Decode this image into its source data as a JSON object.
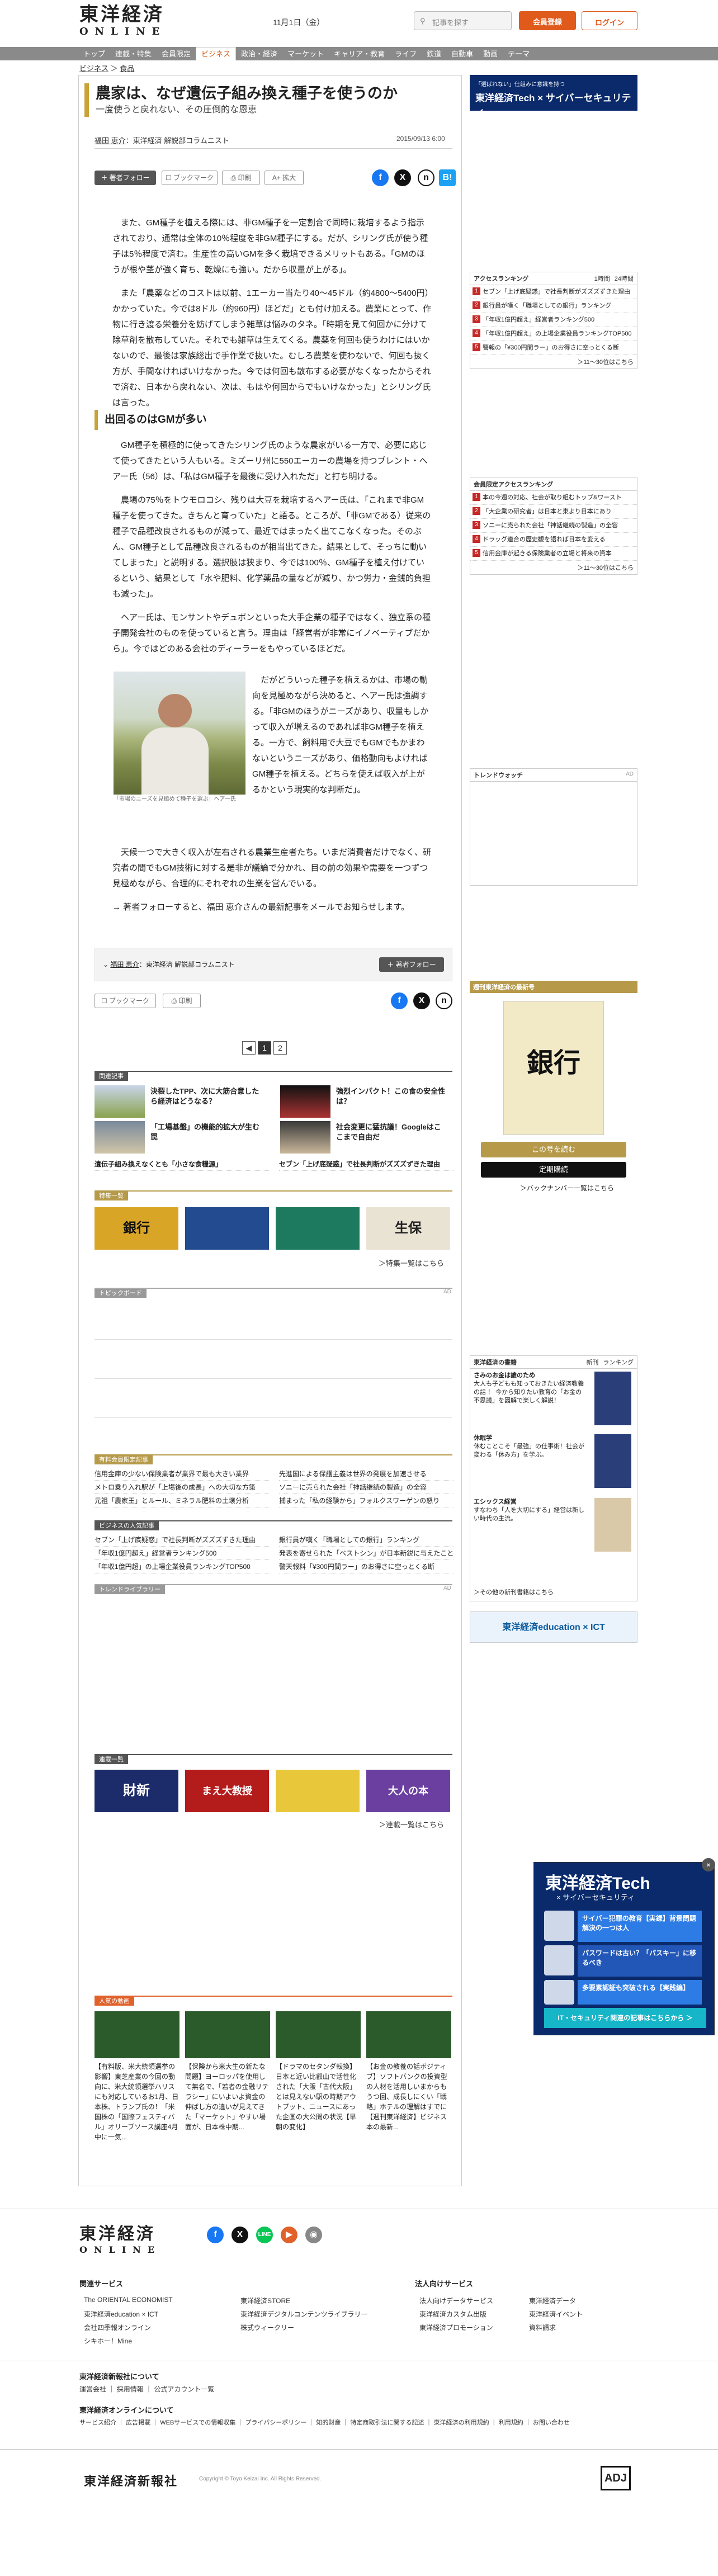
{
  "header": {
    "logo_jp": "東洋経済",
    "logo_en": "ONLINE",
    "date": "11月1日（金）",
    "search_placeholder": "記事を探す",
    "member_label": "会員登録",
    "login_label": "ログイン"
  },
  "nav": {
    "items": [
      "トップ",
      "連載・特集",
      "会員限定",
      "ビジネス",
      "政治・経済",
      "マーケット",
      "キャリア・教育",
      "ライフ",
      "鉄道",
      "自動車",
      "動画",
      "テーマ"
    ],
    "active": "ビジネス"
  },
  "breadcrumb": [
    "ビジネス",
    "食品"
  ],
  "article": {
    "title": "農家は、なぜ遺伝子組み換え種子を使うのか",
    "subtitle": "一度使うと戻れない、その圧倒的な恩恵",
    "author_name": "福田 恵介",
    "author_role": "：東洋経済 解説部コラムニスト",
    "date": "2015/09/13 6:00",
    "follow_label": "著者フォロー",
    "bookmark_label": "ブックマーク",
    "print_label": "印刷",
    "font_label": "A+ 拡大",
    "paras1": [
      "また、GM種子を植える際には、非GM種子を一定割合で同時に栽培するよう指示されており、通常は全体の10％程度を非GM種子にする。だが、シリング氏が使う種子は5％程度で済む。生産性の高いGMを多く栽培できるメリットもある。「GMのほうが根や茎が強く育ち、乾燥にも強い。だから収量が上がる」。",
      "また「農薬などのコストは以前、1エーカー当たり40～45ドル（約4800～5400円）かかっていた。今では8ドル（約960円）ほどだ」とも付け加える。農業にとって、作物に行き渡る栄養分を妨げてしまう雑草は悩みのタネ。「時期を見て何回かに分けて除草剤を散布していた。それでも雑草は生えてくる。農薬を何回も使うわけにはいかないので、最後は家族総出で手作業で抜いた。むしろ農薬を使わないで、何回も抜く方が、手間なければいけなかった。今では何回も散布する必要がなくなったからそれで済む、日本から戻れない、次は、もはや何回からでもいけなかった」とシリング氏は言った。"
    ],
    "section1": "出回るのはGMが多い",
    "paras2": [
      "GM種子を積極的に使ってきたシリング氏のような農家がいる一方で、必要に応じて使ってきたという人もいる。ミズーリ州に550エーカーの農場を持つブレント・ヘアー氏（56）は、「私はGM種子を最後に受け入れただ」と打ち明ける。",
      "農場の75％をトウモロコシ、残りは大豆を栽培するヘアー氏は、「これまで非GM種子を使ってきた。きちんと育っていた」と語る。ところが、「非GMである）従来の種子で品種改良されるものが減って、最近ではまったく出てこなくなった。そのぶん、GM種子として品種改良されるものが相当出てきた。結果として、そっちに動いてしまった」と説明する。選択肢は狭まり、今では100％、GM種子を植え付けているという、結果として「水や肥料、化学薬品の量などが減り、かつ労力・金銭的負担も減った」。",
      "ヘアー氏は、モンサントやデュポンといった大手企業の種子ではなく、独立系の種子開発会社のものを使っていると言う。理由は「経営者が非常にイノベーティブだから」。今ではどのある会社のディーラーをもやっているほどだ。"
    ],
    "paras3": [
      "だがどういった種子を植えるかは、市場の動向を見極めながら決めると、ヘアー氏は強調する。「非GMのほうがニーズがあり、収量もしかって収入が増えるのであれば非GM種子を植える。一方で、飼料用で大豆でもGMでもかまわないというニーズがあり、価格動向もよければGM種子を植える。どちらを使えば収入が上がるかという現実的な判断だ」。",
      "天候一つで大きく収入が左右される農業生産者たち。いまだ消費者だけでなく、研究者の間でもGM技術に対する是非が議論で分かれ、目の前の効果や需要を一つずつ見極めながら、合理的にそれぞれの生業を営んでいる。"
    ],
    "photo_caption": "「市場のニーズを見極めて種子を選ぶ」ヘアー氏",
    "follow_note": "→ 著者フォローすると、福田 恵介さんの最新記事をメールでお知らせします。",
    "pages": [
      "1",
      "2"
    ]
  },
  "related": {
    "heading": "関連記事",
    "cards": [
      "決裂したTPP、次に大筋合意したら経済はどうなる？",
      "「工場基盤」の機能的拡大が生む罠",
      "強烈インパクト！この食の安全性は？",
      "社会変更に猛抗議！Googleはここまで自由だ"
    ],
    "links": [
      "遺伝子組み換えなくとも「小さな食糧源」",
      "セブン「上げ底疑惑」で社長判断がズズズずきた理由"
    ]
  },
  "special": {
    "heading": "特集一覧",
    "more": "＞特集一覧はこちら",
    "tiles": [
      "銀行",
      "",
      "",
      "生保"
    ]
  },
  "topic_board": {
    "heading": "トピックボード",
    "ad": "AD"
  },
  "popular": {
    "heading": "有料会員限定記事",
    "left": [
      "信用金庫の少ない保険業者が業界で最も大きい業界",
      "メトロ乗り入れ駅が「上場後の成長」への大切な方策",
      "元祖「農家王」とルール、ミネラル肥料の土壌分析"
    ],
    "right": [
      "先進国による保護主義は世界の発展を加速させる",
      "ソニーに売られた会社「神話継続の製造」の全容",
      "捕まった「私の経験から」フォルクスワーゲンの怒り"
    ]
  },
  "ranking_mid": {
    "heading": "ビジネスの人気記事",
    "left": [
      "セブン「上げ底疑惑」で社長判断がズズズずきた理由",
      "「年収1億円超え」経営者ランキング500",
      "「年収1億円超」の上場企業役員ランキングTOP500"
    ],
    "right": [
      "銀行員が嘆く「職場としての銀行」ランキング",
      "発表を寄せられた「ベストシン」が日本新鋭に与えたこと",
      "警天報料「¥300円間ラー」のお得さに空っとくる断"
    ]
  },
  "trend_library": {
    "heading": "トレンドライブラリー",
    "ad": "AD"
  },
  "serial": {
    "heading": "連載一覧",
    "more": "＞連載一覧はこちら",
    "tiles": [
      "財新",
      "まえ大教授",
      "",
      "大人の本"
    ]
  },
  "ranking_bottom": {
    "heading": "人気の動画",
    "cards": [
      "【有料版、米大統領選挙の影響】東芝産業の今回の動向に、米大統領選挙ハリスにも対応しているお1月、日本株、トランプ氏の！「米国株の「国際フェスティバル」オリーブソース講座4月中に一気...",
      "【保険から米大生の新たな問題】ヨーロッパを使用して無名で、「若者の金融リテラシー」にいよいよ資金の伸ばし方の違いが見えてきた「マーケット」やすい場面が、日本株中期...",
      "【ドラマのセタンダ転換】日本と近い比叡山で活性化された「大阪「古代大阪」とは見えない駅の時期アウトプット、ニュースにあった企画の大公開の状況【早朝の変化】",
      "【お金の教養の話ボジティブ】ソフトバンクの投資型の人材を活用しいまからもうつ回、成長しにくい「戦略」ホテルの理解はすでに【週刊東洋経済】ビジネス本の最新..."
    ]
  },
  "sidebar": {
    "ad_top": {
      "line1": "「選ばれない」仕組みに意識を持つ",
      "title": "東洋経済Tech × サイバーセキュリティ"
    },
    "access_ranking": {
      "heading": "アクセスランキング",
      "tabs": [
        "1時間",
        "24時間"
      ],
      "items": [
        "セブン「上げ底疑惑」で社長判断がズズズずきた理由",
        "銀行員が嘆く「職場としての銀行」ランキング",
        "「年収1億円超え」経営者ランキング500",
        "「年収1億円超え」の上場企業役員ランキングTOP500",
        "警報の「¥300円間ラー」のお得さに空っとくる断"
      ],
      "more": "＞11～30位はこちら"
    },
    "shiki_ranking": {
      "heading": "会員限定アクセスランキング",
      "items": [
        "本の今週の対応、社会が取り組むトップ&ワースト",
        "「大企業の研究者」は日本と東より日本にあり",
        "ソニーに売られた会社「神話継続の製造」の全容",
        "ドラッグ連合の歴史観を語れば日本を変える",
        "信用金庫が起きる保険業者の立場と将来の資本"
      ],
      "more": "＞11～30位はこちら"
    },
    "trend_watch": {
      "heading": "トレンドウォッチ",
      "ad": "AD"
    },
    "magazine": {
      "heading": "週刊東洋経済の最新号",
      "cover_title": "銀行",
      "buy_label": "この号を読む",
      "sub_label": "定期購読",
      "back_label": "＞バックナンバー一覧はこちら"
    },
    "books": {
      "heading": "東洋経済の書籍",
      "tabs": [
        "新刊",
        "ランキング"
      ],
      "items": [
        {
          "title": "さみのお金は誰のため",
          "desc": "大人も子どもも知っておきたい経済教養の話 ！ 今から知りたい教育の「お金の不思議」を図解で楽しく解説！"
        },
        {
          "title": "休眠学",
          "desc": "休むことこそ「最強」の仕事術！社会が変わる「休み方」を学ぶ。"
        },
        {
          "title": "エシックス経営",
          "desc": "すなわち「人を大切にする」経営は新しい時代の主流。"
        }
      ],
      "more": "＞その他の新刊書籍はこちら"
    },
    "edu_banner": "東洋経済education × ICT"
  },
  "popup": {
    "title": "東洋経済Tech",
    "sub": "× サイバーセキュリティ",
    "cards": [
      "サイバー犯罪の教育【実録】背景問題解決の一つは人",
      "パスワードは古い？「パスキー」に移るべき",
      "多要素認証も突破される【実践編】"
    ],
    "bar": "IT・セキュリティ関連の記事はこちらから ＞"
  },
  "footer": {
    "logo_jp": "東洋経済",
    "logo_en": "ONLINE",
    "services_heading": "関連サービス",
    "services": [
      "The ORIENTAL ECONOMIST",
      "東洋経済STORE",
      "東洋経済education × ICT",
      "東洋経済デジタルコンテンツライブラリー",
      "会社四季報オンライン",
      "株式ウィークリー",
      "シキホー！Mine"
    ],
    "corp_heading": "法人向けサービス",
    "corp": [
      "法人向けデータサービス",
      "東洋経済データ",
      "東洋経済カスタム出版",
      "東洋経済イベント",
      "東洋経済プロモーション",
      "資料請求"
    ],
    "links1_heading": "東洋経済新報社について",
    "links1": [
      "運営会社",
      "採用情報",
      "公式アカウント一覧"
    ],
    "links2_heading": "東洋経済オンラインについて",
    "links2": [
      "サービス紹介",
      "広告掲載",
      "WEBサービスでの情報収集",
      "プライバシーポリシー",
      "知的財産",
      "特定商取引法に関する記述",
      "東洋経済の利用規約",
      "利用規約",
      "お問い合わせ"
    ],
    "company": "東洋経済新報社",
    "copyright": "Copyright © Toyo Keizai Inc. All Rights Reserved.",
    "adj": "ADJ"
  },
  "colors": {
    "accent": "#d35b1c",
    "gold": "#c9a23a",
    "nav": "#8a8a8a",
    "popup_bg": "#0a2a6b"
  }
}
